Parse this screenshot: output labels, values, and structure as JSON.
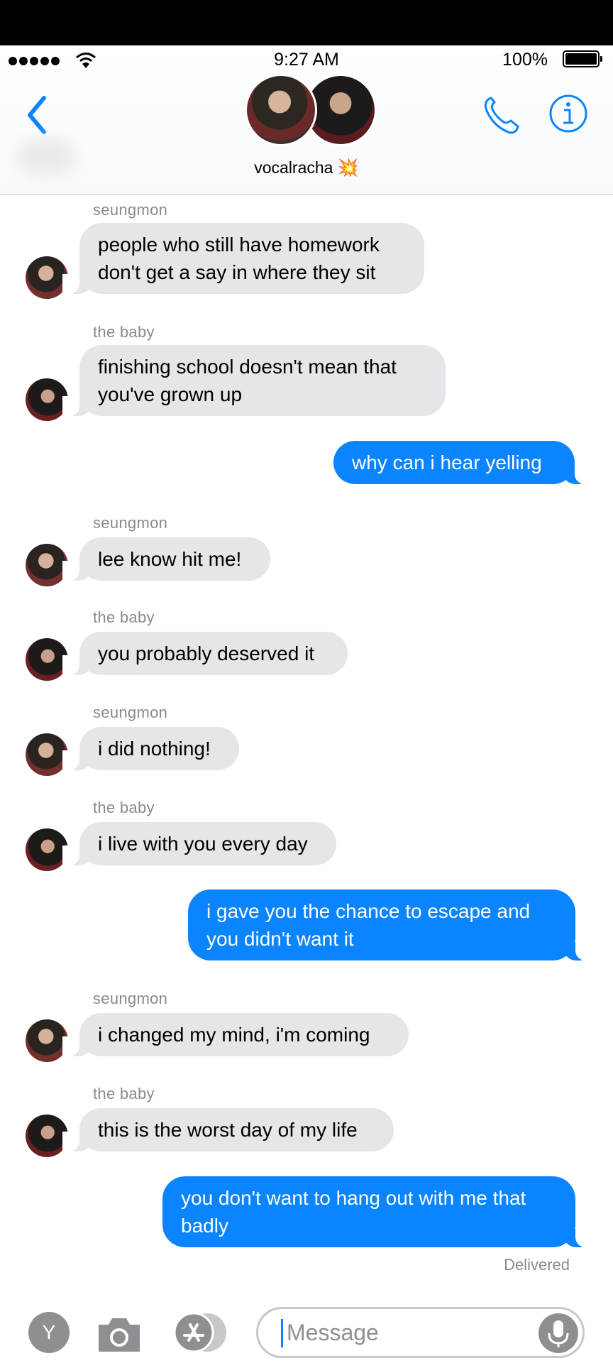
{
  "status_bar": {
    "time": "9:27 AM",
    "battery": "100%"
  },
  "header": {
    "group_name": "vocalracha",
    "group_emoji": "💥",
    "icons": [
      "chevron-left-icon",
      "phone-icon",
      "info-icon"
    ],
    "accent_color": "#0a84ff"
  },
  "messages": [
    {
      "from": "seungmon",
      "direction": "in",
      "avatar": "seung",
      "text": "people who still have homework don't get a say in where they sit"
    },
    {
      "from": "the baby",
      "direction": "in",
      "avatar": "baby",
      "text": "finishing school doesn't mean that you've grown up"
    },
    {
      "from": "me",
      "direction": "out",
      "text": "why can i hear yelling"
    },
    {
      "from": "seungmon",
      "direction": "in",
      "avatar": "seung",
      "text": "lee know hit me!"
    },
    {
      "from": "the baby",
      "direction": "in",
      "avatar": "baby",
      "text": "you probably deserved it"
    },
    {
      "from": "seungmon",
      "direction": "in",
      "avatar": "seung",
      "text": "i did nothing!"
    },
    {
      "from": "the baby",
      "direction": "in",
      "avatar": "baby",
      "text": "i live with you every day"
    },
    {
      "from": "me",
      "direction": "out",
      "text": "i gave you the chance to escape and you didn't want it"
    },
    {
      "from": "seungmon",
      "direction": "in",
      "avatar": "seung",
      "text": "i changed my mind, i'm coming"
    },
    {
      "from": "the baby",
      "direction": "in",
      "avatar": "baby",
      "text": "this is the worst day of my life"
    },
    {
      "from": "me",
      "direction": "out",
      "text": "you don't want to hang out with me that badly"
    }
  ],
  "delivered_label": "Delivered",
  "composer": {
    "y_button": "Y",
    "placeholder": "Message"
  },
  "colors": {
    "incoming_bubble": "#e5e5ea",
    "outgoing_bubble": "#0a84ff"
  }
}
